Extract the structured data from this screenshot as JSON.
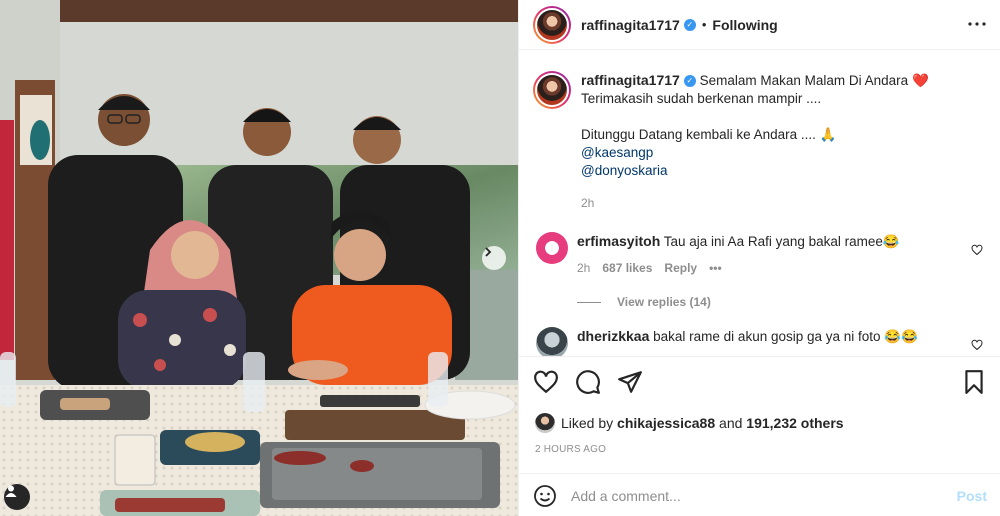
{
  "post": {
    "username": "raffinagita1717",
    "verified_mark": "✓",
    "separator": "•",
    "follow_status": "Following",
    "more_icon": "more-horizontal-icon"
  },
  "caption": {
    "username": "raffinagita1717",
    "verified_mark": "✓",
    "line1": "Semalam Makan Malam Di Andara",
    "line1_emoji": "❤️",
    "line2": "Terimakasih sudah berkenan mampir ....",
    "line3": "Ditunggu Datang kembali ke Andara ....",
    "line3_emoji": "🙏",
    "mention1": "@kaesangp",
    "mention2": "@donyoskaria",
    "time": "2h"
  },
  "comments": [
    {
      "username": "erfimasyitoh",
      "text": "Tau aja ini Aa Rafi yang bakal ramee",
      "emoji": "😂",
      "time": "2h",
      "likes": "687 likes",
      "reply": "Reply",
      "more": "•••",
      "view_replies": "View replies (14)"
    },
    {
      "username": "dherizkkaa",
      "text": "bakal rame di akun gosip ga ya ni foto",
      "emoji": "😂😂"
    }
  ],
  "actions": {
    "like_icon": "heart-icon",
    "comment_icon": "comment-icon",
    "share_icon": "share-icon",
    "save_icon": "bookmark-icon"
  },
  "likes": {
    "prefix": "Liked by",
    "liked_user": "chikajessica88",
    "conj": "and",
    "count": "191,232 others"
  },
  "timestamp": "2 HOURS AGO",
  "add_comment": {
    "placeholder": "Add a comment...",
    "post_label": "Post"
  },
  "colors": {
    "link": "#00376b",
    "verified": "#3897f0",
    "post_disabled": "#b2dffc",
    "muted": "#8e8e8e"
  }
}
